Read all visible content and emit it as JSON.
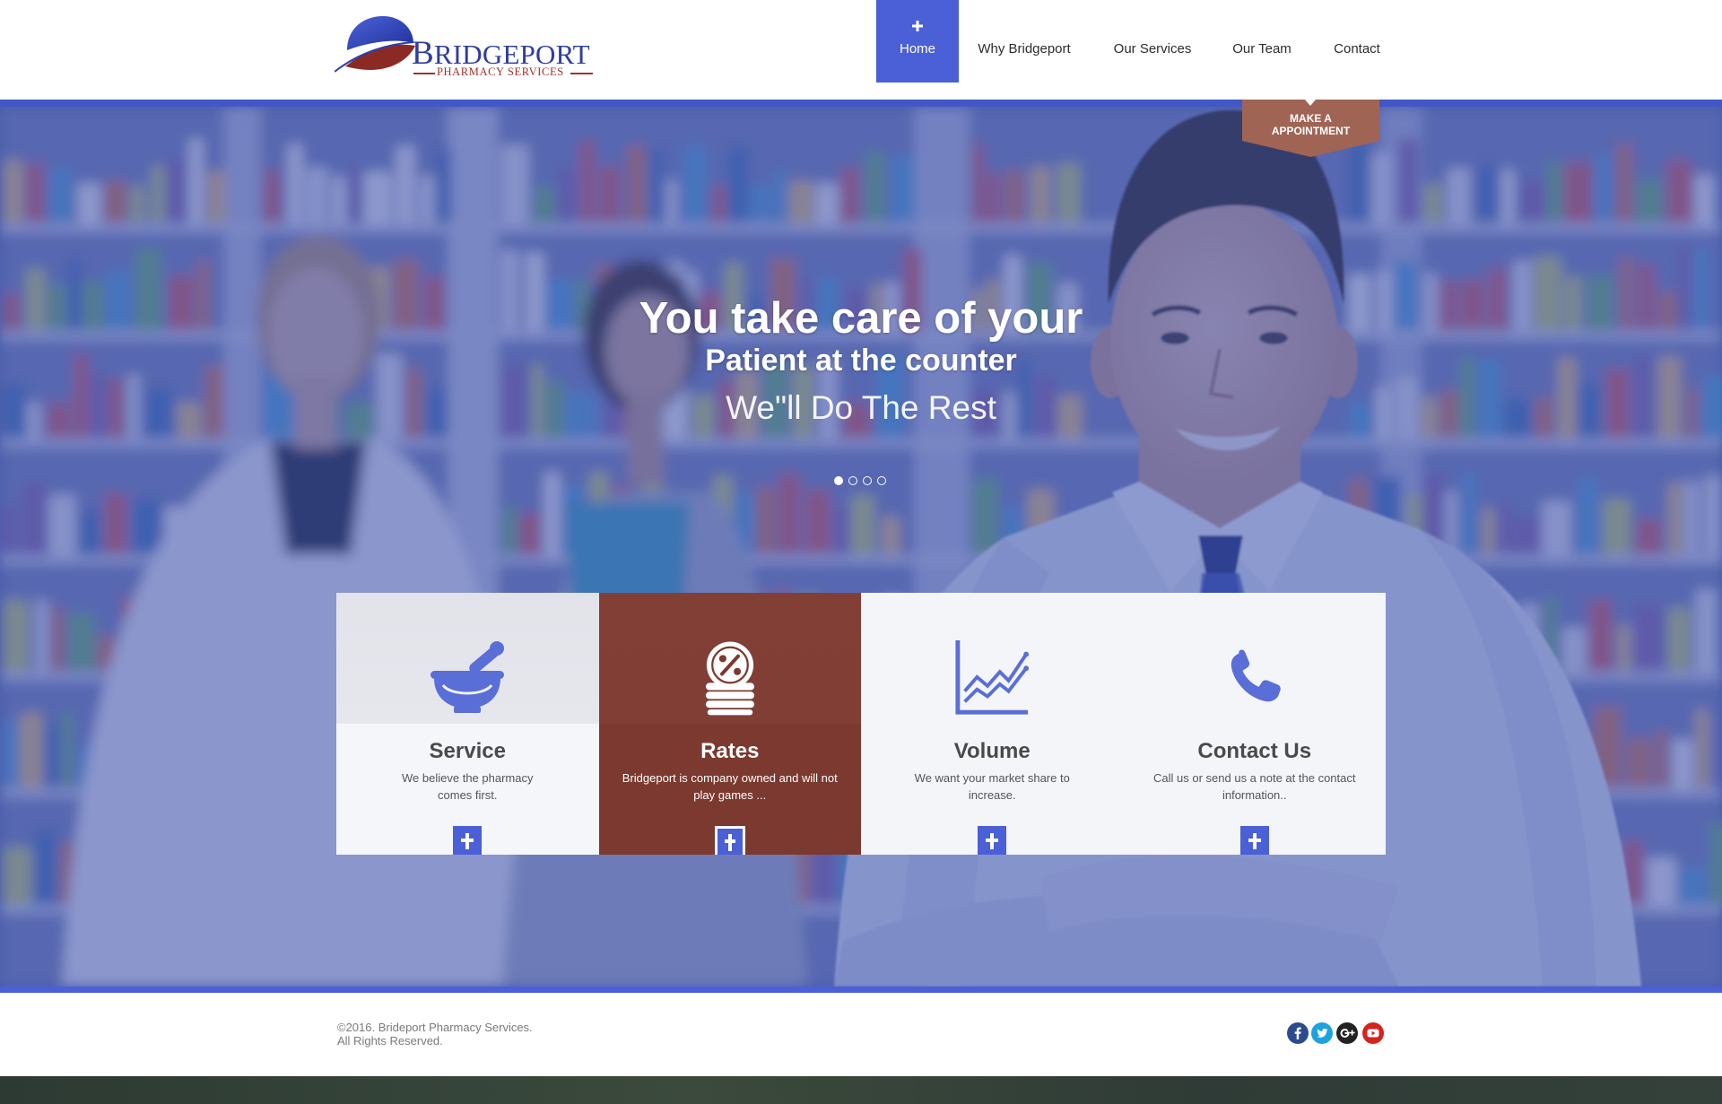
{
  "logo": {
    "name": "BRIDGEPORT",
    "tagline": "PHARMACY SERVICES"
  },
  "nav": {
    "items": [
      {
        "label": "Home",
        "icon": "plus-icon",
        "active": true
      },
      {
        "label": "Why Bridgeport"
      },
      {
        "label": "Our Services"
      },
      {
        "label": "Our Team"
      },
      {
        "label": "Contact"
      }
    ]
  },
  "appointment": {
    "line1": "MAKE A",
    "line2": "APPOINTMENT"
  },
  "hero": {
    "headline": "You take care of your",
    "subheadline": "Patient at the counter",
    "tagline": "We\"ll Do The Rest",
    "slide_count": 4,
    "active_slide": 0
  },
  "features": [
    {
      "title": "Service",
      "description": "We believe the pharmacy comes first.",
      "icon": "mortar-and-pestle-icon",
      "button_icon": "plus-icon"
    },
    {
      "title": "Rates",
      "description": "Bridgeport is company owned and will not play games ...",
      "icon": "coin-stack-percent-icon",
      "button_icon": "plus-icon",
      "highlighted": true
    },
    {
      "title": "Volume",
      "description": "We want your market share to increase.",
      "icon": "line-chart-icon",
      "button_icon": "plus-icon"
    },
    {
      "title": "Contact Us",
      "description": "Call us or send us a note at the contact information..",
      "icon": "phone-icon",
      "button_icon": "plus-icon"
    }
  ],
  "footer": {
    "copyright": "©2016. Brideport Pharmacy Services.",
    "rights": "All Rights Reserved.",
    "social": [
      {
        "icon": "facebook-icon",
        "color": "#2d4a8e"
      },
      {
        "icon": "twitter-icon",
        "color": "#1ea1e0"
      },
      {
        "icon": "google-plus-icon",
        "color": "#222222"
      },
      {
        "icon": "youtube-icon",
        "color": "#d4231f"
      }
    ]
  },
  "colors": {
    "primary": "#4b5fd6",
    "accent": "#7b392f",
    "appointment": "#a06455",
    "logo_blue": "#2e3e9f",
    "logo_red": "#a5302a"
  }
}
